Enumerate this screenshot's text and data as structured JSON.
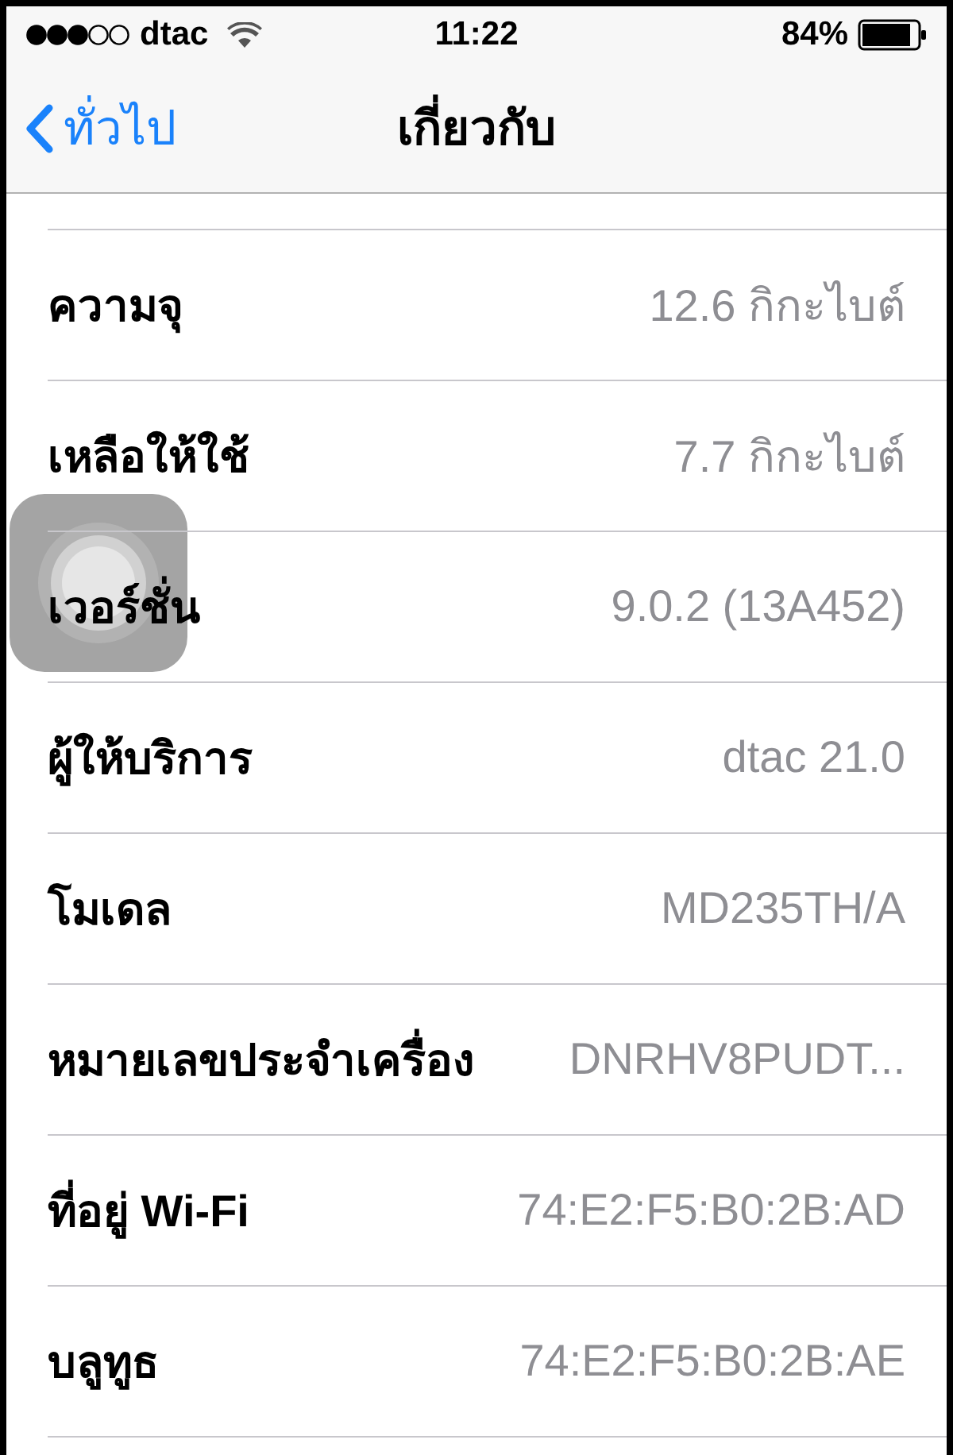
{
  "status_bar": {
    "carrier": "dtac",
    "time": "11:22",
    "battery": "84%"
  },
  "nav": {
    "back": "ทั่วไป",
    "title": "เกี่ยวกับ"
  },
  "rows": [
    {
      "label": "ความจุ",
      "value": "12.6 กิกะไบต์"
    },
    {
      "label": "เหลือให้ใช้",
      "value": "7.7 กิกะไบต์"
    },
    {
      "label": "เวอร์ชั่น",
      "value": "9.0.2 (13A452)"
    },
    {
      "label": "ผู้ให้บริการ",
      "value": "dtac 21.0"
    },
    {
      "label": "โมเดล",
      "value": "MD235TH/A"
    },
    {
      "label": "หมายเลขประจำเครื่อง",
      "value": "DNRHV8PUDT..."
    },
    {
      "label": "ที่อยู่ Wi-Fi",
      "value": "74:E2:F5:B0:2B:AD"
    },
    {
      "label": "บลูทูธ",
      "value": "74:E2:F5:B0:2B:AE"
    }
  ]
}
